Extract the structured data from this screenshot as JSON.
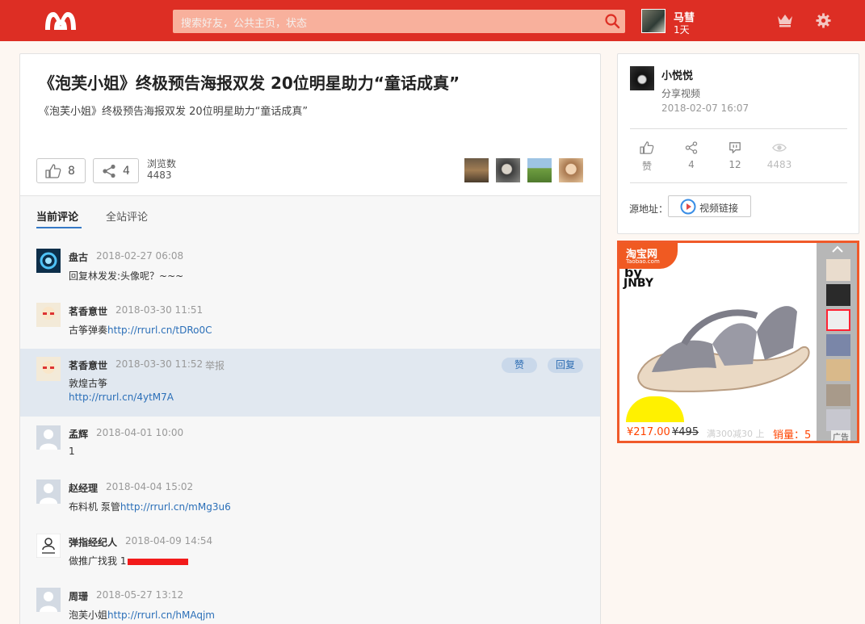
{
  "topbar": {
    "search_placeholder": "搜索好友，公共主页，状态",
    "user_name": "马彗",
    "user_days": "1天"
  },
  "post": {
    "title": "《泡芙小姐》终极预告海报双发 20位明星助力“童话成真”",
    "subtitle": "《泡芙小姐》终极预告海报双发 20位明星助力“童话成真”",
    "likes": "8",
    "shares": "4",
    "views_label": "浏览数",
    "views": "4483"
  },
  "tabs": {
    "current": "当前评论",
    "site": "全站评论"
  },
  "comments": [
    {
      "name": "盘古",
      "time": "2018-02-27 06:08",
      "text": "回复林发发:头像呢？~~~",
      "link": ""
    },
    {
      "name": "茗香意世",
      "time": "2018-03-30 11:51",
      "text": "古筝弹奏",
      "link": "http://rrurl.cn/tDRo0C"
    },
    {
      "name": "茗香意世",
      "time": "2018-03-30 11:52",
      "text": "敦煌古筝",
      "link": "http://rrurl.cn/4ytM7A",
      "report": "举报",
      "like_btn": "赞",
      "reply_btn": "回复"
    },
    {
      "name": "孟辉",
      "time": "2018-04-01 10:00",
      "text": "1",
      "link": ""
    },
    {
      "name": "赵经理",
      "time": "2018-04-04 15:02",
      "text": "布料机 泵管",
      "link": "http://rrurl.cn/mMg3u6"
    },
    {
      "name": "弹指经纪人",
      "time": "2018-04-09 14:54",
      "text": "做推广找我 1",
      "link": ""
    },
    {
      "name": "周珊",
      "time": "2018-05-27 13:12",
      "text": "泡芙小姐",
      "link": "http://rrurl.cn/hMAqjm"
    }
  ],
  "author": {
    "name": "小悦悦",
    "action": "分享视频",
    "time": "2018-02-07 16:07",
    "stats": {
      "like_label": "赞",
      "shares": "4",
      "comments": "12",
      "views": "4483"
    },
    "source_label": "源地址：",
    "source_button": "视频链接"
  },
  "ad": {
    "brand": "淘宝网",
    "brand_sub": "Taobao.com",
    "product_text_1": "by",
    "product_text_2": "JNBY",
    "price": "¥217.00",
    "original_price": "¥495",
    "promo": "满300减30 上",
    "sales": "销量：5",
    "ad_label": "广告"
  }
}
